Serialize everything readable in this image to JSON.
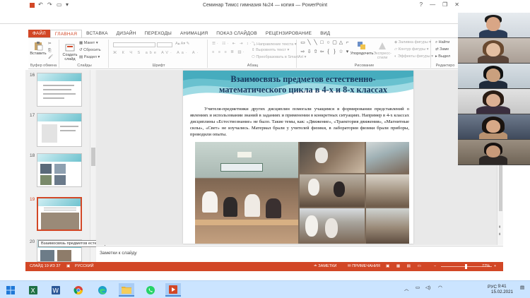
{
  "window": {
    "title": "Семинар Тимсс гимназия №24 — копия — PowerPoint",
    "controls": [
      "?",
      "—",
      "❐",
      "✕"
    ]
  },
  "ribbon": {
    "tabs": [
      "ФАЙЛ",
      "ГЛАВНАЯ",
      "ВСТАВКА",
      "ДИЗАЙН",
      "ПЕРЕХОДЫ",
      "АНИМАЦИЯ",
      "ПОКАЗ СЛАЙДОВ",
      "РЕЦЕНЗИРОВАНИЕ",
      "ВИД"
    ],
    "groups": {
      "clipboard": "Буфер обмена",
      "slides": "Слайды",
      "font": "Шрифт",
      "paragraph": "Абзац",
      "drawing": "Рисование",
      "editing": "Редактиро"
    },
    "paste_label": "Вставить",
    "new_slide_label": "Создать слайд",
    "layout_label": "Макет",
    "reset_label": "Сбросить",
    "section_label": "Раздел",
    "text_direction_label": "Направление текста",
    "align_text_label": "Выровнять текст",
    "smartart_label": "Преобразовать в SmartArt",
    "arrange_label": "Упорядочить",
    "quick_styles_label": "Экспресс-стили",
    "shape_fill_label": "Заливка фигуры",
    "shape_outline_label": "Контур фигуры",
    "shape_effects_label": "Эффекты фигуры",
    "find_label": "Найти",
    "replace_label": "Заме",
    "select_label": "Выдел"
  },
  "thumbnails": [
    {
      "num": "16"
    },
    {
      "num": "17"
    },
    {
      "num": "18"
    },
    {
      "num": "19"
    },
    {
      "num": "20"
    }
  ],
  "tooltip": "Взаимосвязь предметов естес...",
  "slide": {
    "title_line1": "Взаимосвязь предметов естественно-",
    "title_line2": "математического цикла в 4-х и 8-х классах",
    "body": "Учителя-предметники других дисциплин помогали учащимся в формировании представлений о явлениях и использовании знаний в заданиях и применении в конкретных ситуациях. Например в 4-х классах дисциплины «Естествознание» не было. Такие темы, как: «Движение», «Траектория движения», «Магнитные силы», «Свет» не изучались. Материал брали у учителей физики, в лаборатории физики брали приборы, проводили опыты."
  },
  "notes_placeholder": "Заметки к слайду",
  "status": {
    "slide_info": "СЛАЙД 19 ИЗ 37",
    "language": "РУССКИЙ",
    "notes": "ЗАМЕТКИ",
    "comments": "ПРИМЕЧАНИЯ",
    "zoom": "77%"
  },
  "taskbar": {
    "language": "РУС",
    "time": "9:41",
    "date": "15.02.2021"
  },
  "colors": {
    "accent": "#d24726",
    "slide_title": "#17375e",
    "wave": "#5fbccb"
  }
}
